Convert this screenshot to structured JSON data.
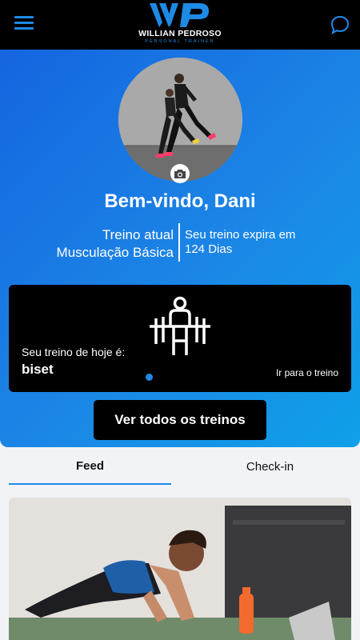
{
  "header": {
    "brand_name": "WILLIAN PEDROSO",
    "brand_sub": "PERSONAL TRAINER",
    "menu_icon": "hamburger-menu-icon",
    "chat_icon": "chat-bubble-icon",
    "accent_color": "#1e8ae6"
  },
  "profile": {
    "welcome": "Bem-vindo, Dani",
    "current_label": "Treino atual",
    "current_plan": "Musculação Básica",
    "expiry_label": "Seu treino expira em",
    "expiry_value": "124 Dias"
  },
  "today": {
    "label": "Seu treino de hoje é:",
    "name": "biset",
    "link": "Ir para o treino",
    "icon": "weightlifting-icon"
  },
  "actions": {
    "all_workouts": "Ver todos os treinos"
  },
  "tabs": [
    {
      "label": "Feed",
      "active": true
    },
    {
      "label": "Check-in",
      "active": false
    }
  ]
}
